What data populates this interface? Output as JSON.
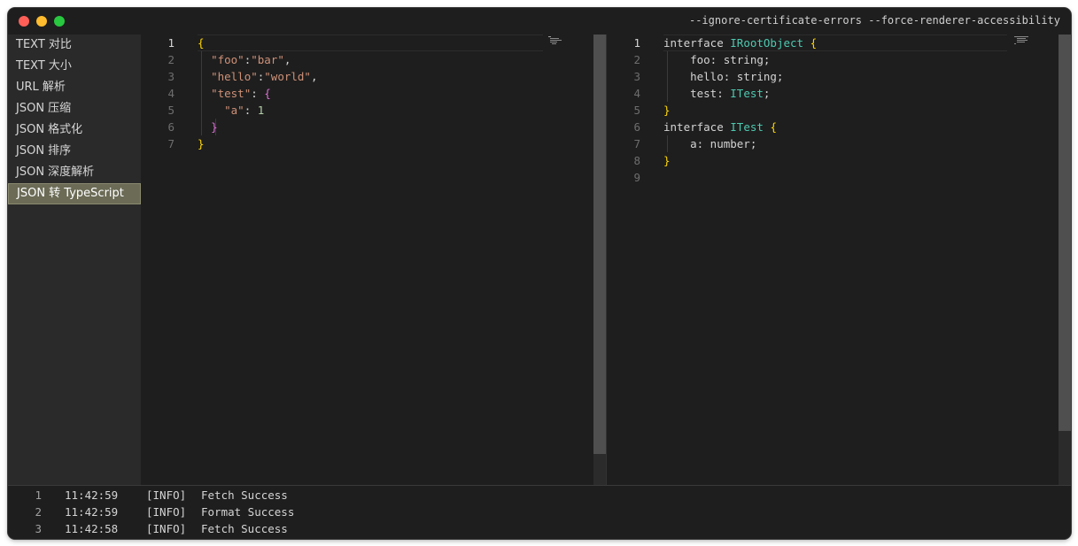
{
  "window": {
    "title": "--ignore-certificate-errors --force-renderer-accessibility",
    "lights": {
      "close": "#ff5f57",
      "minimize": "#febc2e",
      "zoom": "#28c840"
    }
  },
  "sidebar": {
    "items": [
      {
        "label": "TEXT 对比",
        "active": false
      },
      {
        "label": "TEXT 大小",
        "active": false
      },
      {
        "label": "URL 解析",
        "active": false
      },
      {
        "label": "JSON 压缩",
        "active": false
      },
      {
        "label": "JSON 格式化",
        "active": false
      },
      {
        "label": "JSON 排序",
        "active": false
      },
      {
        "label": "JSON 深度解析",
        "active": false
      },
      {
        "label": "JSON 转 TypeScript",
        "active": true
      }
    ]
  },
  "left_editor": {
    "line_numbers": [
      "1",
      "2",
      "3",
      "4",
      "5",
      "6",
      "7"
    ],
    "lines": [
      [
        {
          "t": "{",
          "c": "p"
        }
      ],
      [
        {
          "t": "  ",
          "c": "plain"
        },
        {
          "t": "\"foo\"",
          "c": "key"
        },
        {
          "t": ":",
          "c": "plain"
        },
        {
          "t": "\"bar\"",
          "c": "str"
        },
        {
          "t": ",",
          "c": "plain"
        }
      ],
      [
        {
          "t": "  ",
          "c": "plain"
        },
        {
          "t": "\"hello\"",
          "c": "key"
        },
        {
          "t": ":",
          "c": "plain"
        },
        {
          "t": "\"world\"",
          "c": "str"
        },
        {
          "t": ",",
          "c": "plain"
        }
      ],
      [
        {
          "t": "  ",
          "c": "plain"
        },
        {
          "t": "\"test\"",
          "c": "key"
        },
        {
          "t": ": ",
          "c": "plain"
        },
        {
          "t": "{",
          "c": "p2"
        }
      ],
      [
        {
          "t": "    ",
          "c": "plain"
        },
        {
          "t": "\"a\"",
          "c": "key"
        },
        {
          "t": ": ",
          "c": "plain"
        },
        {
          "t": "1",
          "c": "num"
        }
      ],
      [
        {
          "t": "  ",
          "c": "plain"
        },
        {
          "t": "}",
          "c": "p2"
        }
      ],
      [
        {
          "t": "}",
          "c": "p"
        }
      ]
    ]
  },
  "right_editor": {
    "line_numbers": [
      "1",
      "2",
      "3",
      "4",
      "5",
      "6",
      "7",
      "8",
      "9"
    ],
    "lines": [
      [
        {
          "t": "interface ",
          "c": "plain"
        },
        {
          "t": "IRootObject",
          "c": "type"
        },
        {
          "t": " ",
          "c": "plain"
        },
        {
          "t": "{",
          "c": "p"
        }
      ],
      [
        {
          "t": "    foo: string;",
          "c": "plain"
        }
      ],
      [
        {
          "t": "    hello: string;",
          "c": "plain"
        }
      ],
      [
        {
          "t": "    test: ",
          "c": "plain"
        },
        {
          "t": "ITest",
          "c": "type"
        },
        {
          "t": ";",
          "c": "plain"
        }
      ],
      [
        {
          "t": "}",
          "c": "p"
        }
      ],
      [
        {
          "t": "interface ",
          "c": "plain"
        },
        {
          "t": "ITest",
          "c": "type"
        },
        {
          "t": " ",
          "c": "plain"
        },
        {
          "t": "{",
          "c": "p"
        }
      ],
      [
        {
          "t": "    a: number;",
          "c": "plain"
        }
      ],
      [
        {
          "t": "}",
          "c": "p"
        }
      ],
      []
    ]
  },
  "console": {
    "rows": [
      {
        "index": "1",
        "time": "11:42:59",
        "level": "[INFO]",
        "message": "Fetch Success"
      },
      {
        "index": "2",
        "time": "11:42:59",
        "level": "[INFO]",
        "message": "Format Success"
      },
      {
        "index": "3",
        "time": "11:42:58",
        "level": "[INFO]",
        "message": "Fetch Success"
      }
    ]
  }
}
